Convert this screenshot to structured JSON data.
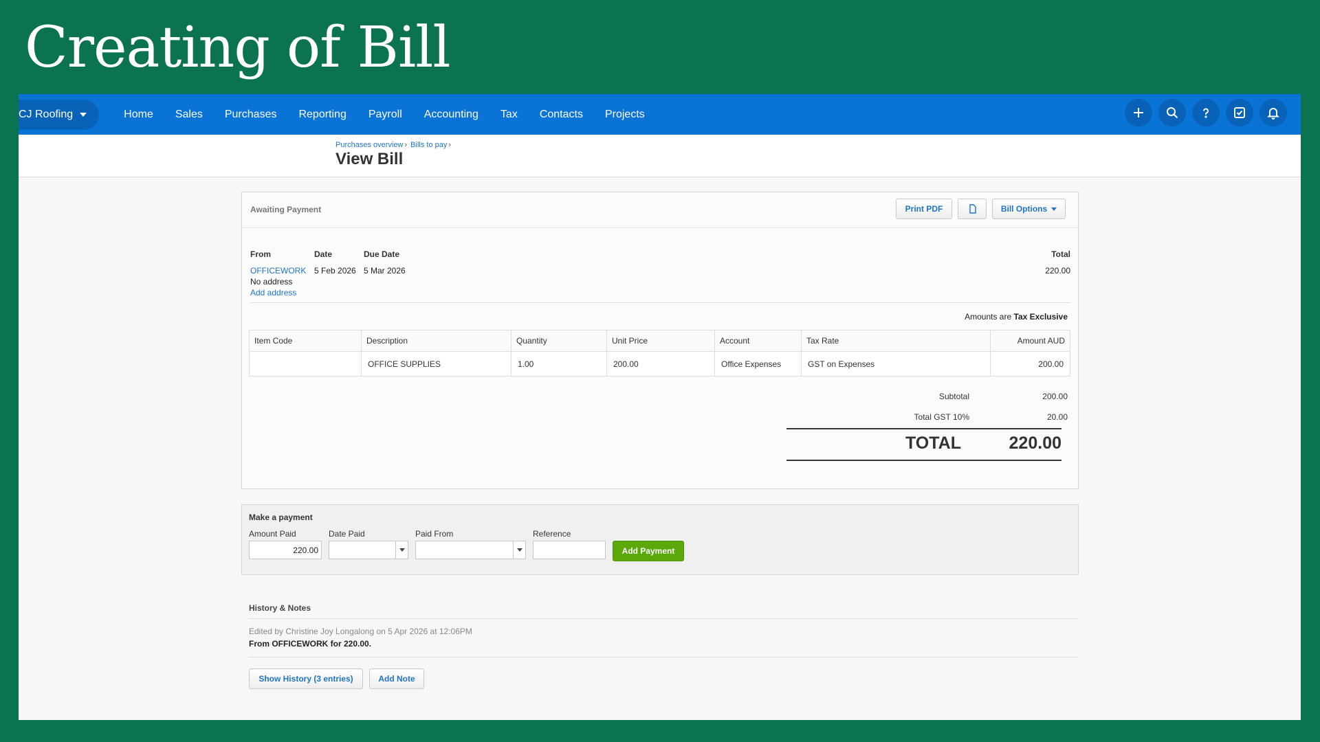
{
  "slide": {
    "title": "Creating of Bill"
  },
  "nav": {
    "org": "CJ Roofing",
    "items": [
      "Home",
      "Sales",
      "Purchases",
      "Reporting",
      "Payroll",
      "Accounting",
      "Tax",
      "Contacts",
      "Projects"
    ],
    "icons": [
      "plus-icon",
      "search-icon",
      "help-icon",
      "tasks-icon",
      "bell-icon"
    ]
  },
  "header": {
    "breadcrumb": [
      "Purchases overview",
      "Bills to pay"
    ],
    "title": "View Bill"
  },
  "bill": {
    "status": "Awaiting Payment",
    "print_pdf": "Print PDF",
    "bill_options": "Bill Options",
    "labels": {
      "from": "From",
      "date": "Date",
      "due_date": "Due Date",
      "total": "Total"
    },
    "from": "OFFICEWORK",
    "no_address": "No address",
    "add_address": "Add address",
    "date": "5 Feb 2026",
    "due_date": "5 Mar 2026",
    "total": "220.00",
    "amounts_are_label": "Amounts are",
    "amounts_are_value": "Tax Exclusive",
    "table": {
      "headers": [
        "Item Code",
        "Description",
        "Quantity",
        "Unit Price",
        "Account",
        "Tax Rate",
        "Amount AUD"
      ],
      "rows": [
        [
          "",
          "OFFICE SUPPLIES",
          "1.00",
          "200.00",
          "Office Expenses",
          "GST on Expenses",
          "200.00"
        ]
      ]
    },
    "subtotal_label": "Subtotal",
    "subtotal": "200.00",
    "gst_label": "Total GST  10%",
    "gst": "20.00",
    "grand_label": "TOTAL",
    "grand_total": "220.00"
  },
  "payment": {
    "title": "Make a payment",
    "labels": {
      "amount_paid": "Amount Paid",
      "date_paid": "Date Paid",
      "paid_from": "Paid From",
      "reference": "Reference"
    },
    "amount_paid": "220.00",
    "date_paid": "",
    "paid_from": "",
    "reference": "",
    "add_payment": "Add Payment"
  },
  "history": {
    "title": "History & Notes",
    "meta": "Edited by Christine Joy Longalong on 5 Apr 2026 at 12:06PM",
    "text": "From OFFICEWORK for 220.00.",
    "show_history": "Show History (3 entries)",
    "add_note": "Add Note"
  }
}
